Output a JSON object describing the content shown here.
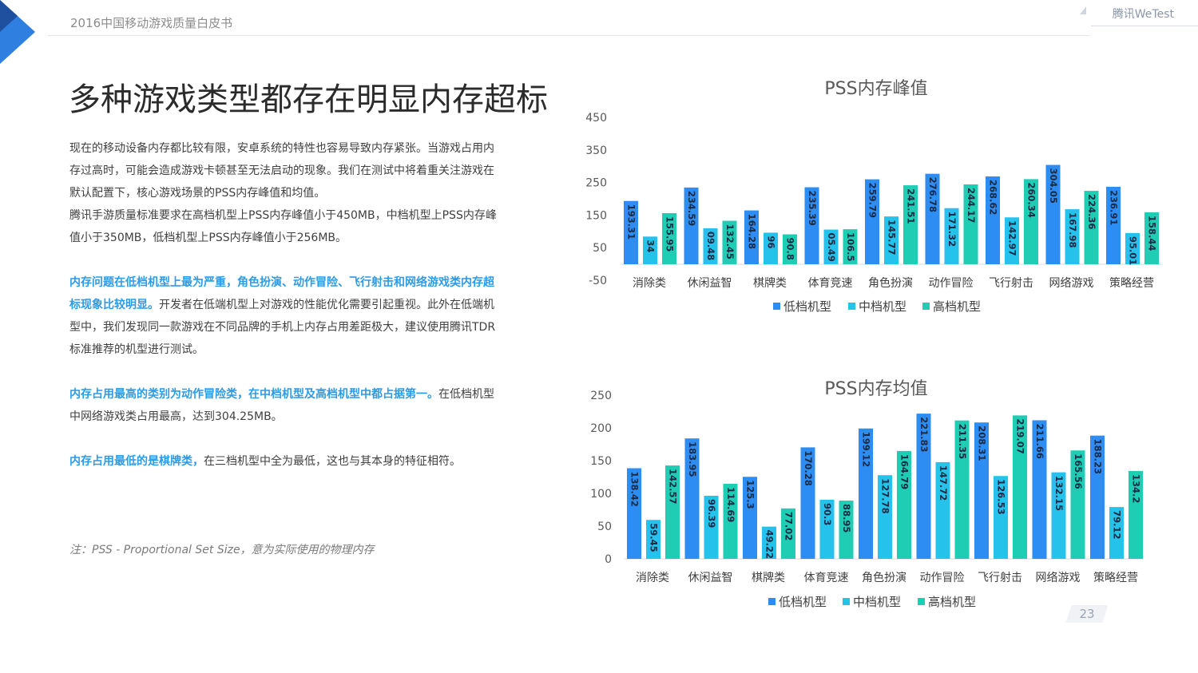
{
  "header": {
    "doc_title": "2016中国移动游戏质量白皮书",
    "brand": "腾讯WeTest"
  },
  "main": {
    "title": "多种游戏类型都存在明显内存超标",
    "p1": "现在的移动设备内存都比较有限，安卓系统的特性也容易导致内存紧张。当游戏占用内存过高时，可能会造成游戏卡顿甚至无法启动的现象。我们在测试中将着重关注游戏在默认配置下，核心游戏场景的PSS内存峰值和均值。",
    "p2": "腾讯手游质量标准要求在高档机型上PSS内存峰值小于450MB，中档机型上PSS内存峰值小于350MB，低档机型上PSS内存峰值小于256MB。",
    "p3_hl": "内存问题在低档机型上最为严重，角色扮演、动作冒险、飞行射击和网络游戏类内存超标现象比较明显。",
    "p3_rest": "开发者在低端机型上对游戏的性能优化需要引起重视。此外在低端机型中，我们发现同一款游戏在不同品牌的手机上内存占用差距极大，建议使用腾讯TDR标准推荐的机型进行测试。",
    "p4_hl": "内存占用最高的类别为动作冒险类，在中档机型及高档机型中都占据第一。",
    "p4_rest": "在低档机型中网络游戏类占用最高，达到304.25MB。",
    "p5_hl": "内存占用最低的是棋牌类，",
    "p5_rest": "在三档机型中全为最低，这也与其本身的特征相符。",
    "note": "注：PSS - Proportional Set Size，意为实际使用的物理内存"
  },
  "page_number": "23",
  "colors": {
    "low": "#2e8df2",
    "mid": "#25c2ec",
    "high": "#1ecdb4",
    "highlight": "#2d9be6"
  },
  "chart_data": [
    {
      "type": "bar",
      "title": "PSS内存峰值",
      "categories": [
        "消除类",
        "休闲益智",
        "棋牌类",
        "体育竞速",
        "角色扮演",
        "动作冒险",
        "飞行射击",
        "网络游戏",
        "策略经营"
      ],
      "series": [
        {
          "name": "低档机型",
          "values": [
            193.31,
            234.59,
            164.28,
            235.39,
            259.79,
            276.78,
            268.62,
            304.05,
            236.91
          ],
          "labels": [
            "193.31",
            "234.59",
            "164.28",
            "235.39",
            "259.79",
            "276.78",
            "268.62",
            "304.05",
            "236.91"
          ]
        },
        {
          "name": "中档机型",
          "values": [
            84,
            109.48,
            96,
            105.49,
            145.77,
            171.32,
            142.97,
            167.98,
            95.01
          ],
          "labels": [
            "34",
            "09.48",
            "96",
            "05.49",
            "145.77",
            "171.32",
            "142.97",
            "167.98",
            "95.01"
          ]
        },
        {
          "name": "高档机型",
          "values": [
            155.95,
            132.45,
            90.8,
            106.5,
            241.51,
            244.17,
            260.34,
            224.36,
            158.44
          ],
          "labels": [
            "155.95",
            "132.45",
            "90.8",
            "106.5",
            "241.51",
            "244.17",
            "260.34",
            "224.36",
            "158.44"
          ]
        }
      ],
      "ylim": [
        -50,
        450
      ],
      "yticks": [
        "450",
        "350",
        "250",
        "150",
        "50",
        "-50"
      ],
      "legend": "bottom"
    },
    {
      "type": "bar",
      "title": "PSS内存均值",
      "categories": [
        "消除类",
        "休闲益智",
        "棋牌类",
        "体育竞速",
        "角色扮演",
        "动作冒险",
        "飞行射击",
        "网络游戏",
        "策略经营"
      ],
      "series": [
        {
          "name": "低档机型",
          "values": [
            138.42,
            183.95,
            125.3,
            170.28,
            199.12,
            221.83,
            208.31,
            211.66,
            188.23
          ],
          "labels": [
            "138.42",
            "183.95",
            "125.3",
            "170.28",
            "199.12",
            "221.83",
            "208.31",
            "211.66",
            "188.23"
          ]
        },
        {
          "name": "中档机型",
          "values": [
            59.45,
            96.39,
            49.22,
            90.3,
            127.78,
            147.72,
            126.53,
            132.15,
            79.12
          ],
          "labels": [
            "59.45",
            "96.39",
            "49.22",
            "90.3",
            "127.78",
            "147.72",
            "126.53",
            "132.15",
            "79.12"
          ]
        },
        {
          "name": "高档机型",
          "values": [
            142.57,
            114.69,
            77.02,
            88.95,
            164.79,
            211.35,
            219.07,
            165.56,
            134.2
          ],
          "labels": [
            "142.57",
            "114.69",
            "77.02",
            "88.95",
            "164.79",
            "211.35",
            "219.07",
            "165.56",
            "134.2"
          ]
        }
      ],
      "ylim": [
        0,
        250
      ],
      "yticks": [
        "250",
        "200",
        "150",
        "100",
        "50",
        "0"
      ],
      "legend": "bottom"
    }
  ]
}
